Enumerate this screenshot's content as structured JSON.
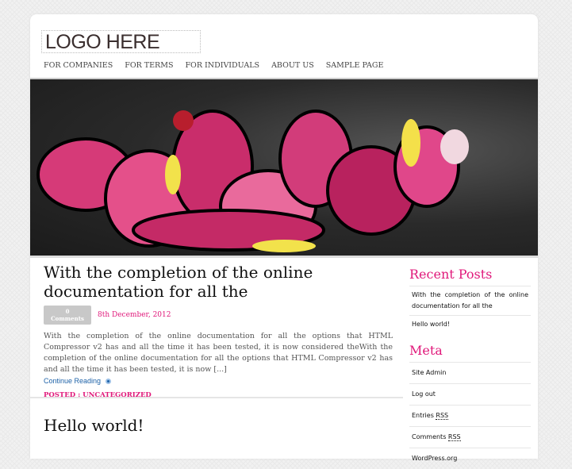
{
  "header": {
    "logo": "LOGO HERE",
    "nav": [
      "FOR COMPANIES",
      "FOR TERMS",
      "FOR INDIVIDUALS",
      "ABOUT US",
      "SAMPLE PAGE"
    ]
  },
  "colors": {
    "accent": "#e0187a",
    "link": "#1e62a8"
  },
  "posts": [
    {
      "title": "With the completion of the online documentation for all the",
      "comments": "0 Comments",
      "date": "8th December, 2012",
      "excerpt": "With the completion of the online documentation for all the options that HTML Compressor v2 has and all the time it has been tested, it is now considered theWith the completion of the online documentation for all the options that HTML Compressor v2 has and all the time it has been tested, it is now [...]",
      "more": "Continue Reading",
      "posted": "POSTED : UNCATEGORIZED"
    },
    {
      "title": "Hello world!"
    }
  ],
  "sidebar": {
    "recent_title": "Recent Posts",
    "recent": [
      "With the completion of the online documentation for all the",
      "Hello world!"
    ],
    "meta_title": "Meta",
    "meta": {
      "admin": "Site Admin",
      "logout": "Log out",
      "entries": "Entries",
      "comments": "Comments",
      "rss": "RSS",
      "wp": "WordPress.org"
    }
  }
}
